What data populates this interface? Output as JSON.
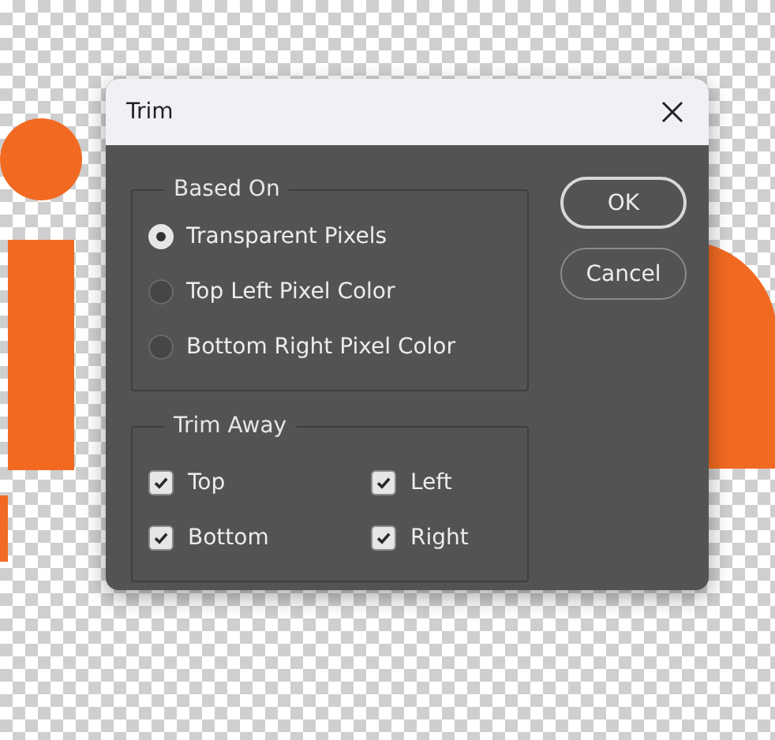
{
  "dialog": {
    "title": "Trim"
  },
  "based_on": {
    "legend": "Based On",
    "options": [
      {
        "label": "Transparent Pixels",
        "selected": true
      },
      {
        "label": "Top Left Pixel Color",
        "selected": false
      },
      {
        "label": "Bottom Right Pixel Color",
        "selected": false
      }
    ]
  },
  "trim_away": {
    "legend": "Trim Away",
    "options": [
      {
        "label": "Top",
        "checked": true
      },
      {
        "label": "Left",
        "checked": true
      },
      {
        "label": "Bottom",
        "checked": true
      },
      {
        "label": "Right",
        "checked": true
      }
    ]
  },
  "buttons": [
    {
      "label": "OK",
      "default": true
    },
    {
      "label": "Cancel",
      "default": false
    }
  ]
}
